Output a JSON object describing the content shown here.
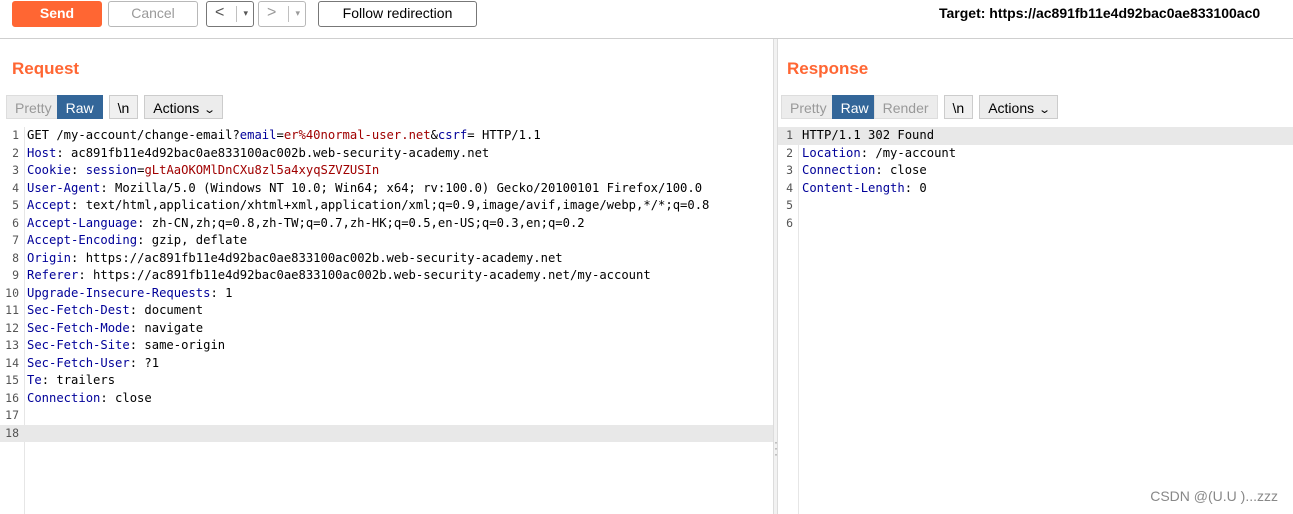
{
  "toolbar": {
    "send": "Send",
    "cancel": "Cancel",
    "back": "<",
    "forward": ">",
    "dropdown": "▾",
    "follow": "Follow redirection",
    "target": "Target: https://ac891fb11e4d92bac0ae833100ac0"
  },
  "request": {
    "title": "Request",
    "tabs": [
      "Pretty",
      "Raw",
      "\\n",
      "Actions"
    ],
    "lines": [
      {
        "n": "1",
        "parts": [
          [
            "t",
            "GET /my-account/change-email?"
          ],
          [
            "k",
            "email"
          ],
          [
            "t",
            "="
          ],
          [
            "r",
            "er%40normal-user.net"
          ],
          [
            "t",
            "&"
          ],
          [
            "k",
            "csrf"
          ],
          [
            "t",
            "= HTTP/1.1"
          ]
        ]
      },
      {
        "n": "2",
        "parts": [
          [
            "k",
            "Host"
          ],
          [
            "t",
            ": ac891fb11e4d92bac0ae833100ac002b.web-security-academy.net"
          ]
        ]
      },
      {
        "n": "3",
        "parts": [
          [
            "k",
            "Cookie"
          ],
          [
            "t",
            ": "
          ],
          [
            "k",
            "session"
          ],
          [
            "t",
            "="
          ],
          [
            "r",
            "gLtAaOKOMlDnCXu8zl5a4xyqSZVZUSIn"
          ]
        ]
      },
      {
        "n": "4",
        "parts": [
          [
            "k",
            "User-Agent"
          ],
          [
            "t",
            ": Mozilla/5.0 (Windows NT 10.0; Win64; x64; rv:100.0) Gecko/20100101 Firefox/100.0"
          ]
        ]
      },
      {
        "n": "5",
        "parts": [
          [
            "k",
            "Accept"
          ],
          [
            "t",
            ": text/html,application/xhtml+xml,application/xml;q=0.9,image/avif,image/webp,*/*;q=0.8"
          ]
        ]
      },
      {
        "n": "6",
        "parts": [
          [
            "k",
            "Accept-Language"
          ],
          [
            "t",
            ": zh-CN,zh;q=0.8,zh-TW;q=0.7,zh-HK;q=0.5,en-US;q=0.3,en;q=0.2"
          ]
        ]
      },
      {
        "n": "7",
        "parts": [
          [
            "k",
            "Accept-Encoding"
          ],
          [
            "t",
            ": gzip, deflate"
          ]
        ]
      },
      {
        "n": "8",
        "parts": [
          [
            "k",
            "Origin"
          ],
          [
            "t",
            ": https://ac891fb11e4d92bac0ae833100ac002b.web-security-academy.net"
          ]
        ]
      },
      {
        "n": "9",
        "parts": [
          [
            "k",
            "Referer"
          ],
          [
            "t",
            ": https://ac891fb11e4d92bac0ae833100ac002b.web-security-academy.net/my-account"
          ]
        ]
      },
      {
        "n": "10",
        "parts": [
          [
            "k",
            "Upgrade-Insecure-Requests"
          ],
          [
            "t",
            ": 1"
          ]
        ]
      },
      {
        "n": "11",
        "parts": [
          [
            "k",
            "Sec-Fetch-Dest"
          ],
          [
            "t",
            ": document"
          ]
        ]
      },
      {
        "n": "12",
        "parts": [
          [
            "k",
            "Sec-Fetch-Mode"
          ],
          [
            "t",
            ": navigate"
          ]
        ]
      },
      {
        "n": "13",
        "parts": [
          [
            "k",
            "Sec-Fetch-Site"
          ],
          [
            "t",
            ": same-origin"
          ]
        ]
      },
      {
        "n": "14",
        "parts": [
          [
            "k",
            "Sec-Fetch-User"
          ],
          [
            "t",
            ": ?1"
          ]
        ]
      },
      {
        "n": "15",
        "parts": [
          [
            "k",
            "Te"
          ],
          [
            "t",
            ": trailers"
          ]
        ]
      },
      {
        "n": "16",
        "parts": [
          [
            "k",
            "Connection"
          ],
          [
            "t",
            ": close"
          ]
        ]
      },
      {
        "n": "17",
        "parts": []
      },
      {
        "n": "18",
        "parts": [],
        "highlight": true
      }
    ]
  },
  "response": {
    "title": "Response",
    "tabs": [
      "Pretty",
      "Raw",
      "Render",
      "\\n",
      "Actions"
    ],
    "lines": [
      {
        "n": "1",
        "parts": [
          [
            "t",
            "HTTP/1.1 302 Found"
          ]
        ],
        "highlight": true
      },
      {
        "n": "2",
        "parts": [
          [
            "k",
            "Location"
          ],
          [
            "t",
            ": /my-account"
          ]
        ]
      },
      {
        "n": "3",
        "parts": [
          [
            "k",
            "Connection"
          ],
          [
            "t",
            ": close"
          ]
        ]
      },
      {
        "n": "4",
        "parts": [
          [
            "k",
            "Content-Length"
          ],
          [
            "t",
            ": 0"
          ]
        ]
      },
      {
        "n": "5",
        "parts": []
      },
      {
        "n": "6",
        "parts": []
      }
    ]
  },
  "watermark": "CSDN @(U.U )...zzz",
  "colors": {
    "accent": "#ff6633",
    "active_tab": "#336699",
    "header_key": "#000099",
    "param_value": "#a00000"
  }
}
